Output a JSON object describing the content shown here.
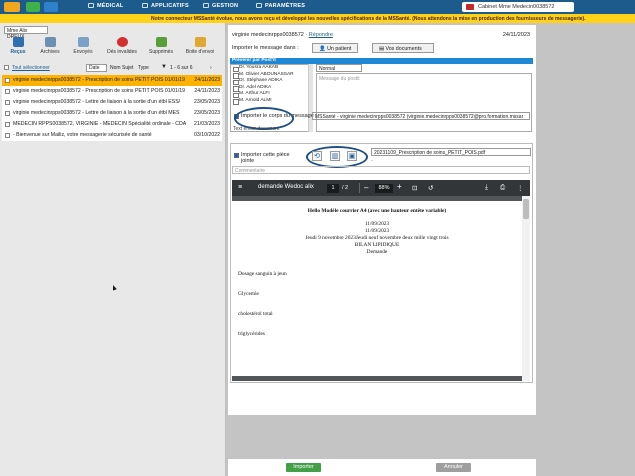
{
  "nav": {
    "items": [
      "MÉDICAL",
      "APPLICATIFS",
      "GESTION",
      "PARAMÈTRES"
    ],
    "cabinet": "Cabinet Mme Medecin0038572"
  },
  "banner": "Notre connecteur MSSanté évolue, nous avons reçu et développé les nouvelles spécifications de la MSSanté. (Nous attendons la mise en production des fournisseurs de messagerie).",
  "sidebar": {
    "mailbox": "Mme Alix DREUX",
    "toolbar": [
      "Reçus",
      "Archives",
      "Envoyés",
      "Dés invalides",
      "Supprimés",
      "Boite d'envoi"
    ],
    "filter": {
      "select_all": "Tout sélectionner",
      "sort_by": "Date",
      "columns": [
        "Nom",
        "Sujet",
        "Type"
      ],
      "pagination": "1 - 6 sur 6"
    },
    "mails": [
      {
        "subject": "virginie medecinrpps0038572 - Prescription de soins PETIT POIS 01/01/19",
        "date": "24/11/2023",
        "selected": true
      },
      {
        "subject": "virginie medecinrpps0038572 - Prescription de soins PETIT POIS 01/01/19",
        "date": "24/11/2023",
        "selected": false
      },
      {
        "subject": "virginie medecinrpps0038572 - Lettre de liaison à la sortie d'un étbl ESS/",
        "date": "23/05/2023",
        "selected": false
      },
      {
        "subject": "virginie medecinrpps0038572 - Lettre de liaison à la sortie d'un étbl MES",
        "date": "23/05/2023",
        "selected": false
      },
      {
        "subject": "MEDECIN RPPS0038572, VIRGINIE - MEDECIN Spécialité ordinale - CDA",
        "date": "21/03/2023",
        "selected": false
      },
      {
        "subject": "- Bienvenue sur Mailiz, votre messagerie sécurisée de santé",
        "date": "03/10/2022",
        "selected": false
      }
    ]
  },
  "detail": {
    "from_name": "virginie medecinrpps0038572",
    "reply_link": "Répondre",
    "date": "24/11/2023",
    "import_label": "Importer le message dans :",
    "dest_patient": "Un patient",
    "dest_docs": "Vos documents",
    "notify_header": "Prévenir par Post'it",
    "doctors": [
      "Dr. Yousra AAKAB",
      "M. Olivier ABOUNASSAR",
      "Dr. Stéphane ADIKA",
      "Dr. Adel ADIKA",
      "M. Arthur ALFI",
      "M. Arnold ALMI"
    ],
    "priority": "Normal",
    "message_placeholder": "Message du postit",
    "import_body_label": "Importer le corps du message",
    "body_value": "MSSanté - virginie medecinrpps0038572 (virginie.medecinrpps0038572@pro.formation.mssar",
    "full_text_label": "Text entier document",
    "import_pj_label": "Importer cette pièce jointe",
    "pj_file": "20231109_Prescription de soins_PETIT_POIS.pdf",
    "pj_dash": "-",
    "comment_placeholder": "Commentaire"
  },
  "pdf": {
    "title": "demande Wedoc alix",
    "page": "1",
    "pages": "/ 2",
    "zoom": "88%",
    "lines": {
      "heading": "Hello Modèle courrier A4 (avec une hauteur entête variable)",
      "date1": "11/09/2023",
      "date2": "11/09/2023",
      "date3": "Jeudi 9 novembre 2023Jeudi neuf novembre deux mille vingt trois",
      "bilan": "BILAN LIPIDIQUE",
      "demande": "Demande",
      "item1": "Dosage sanguin à  jeun",
      "item2": "Glycemie",
      "item3": "cholestérol total",
      "item4": "triglycérides"
    }
  },
  "buttons": {
    "import": "Importer",
    "cancel": "Annuler"
  }
}
